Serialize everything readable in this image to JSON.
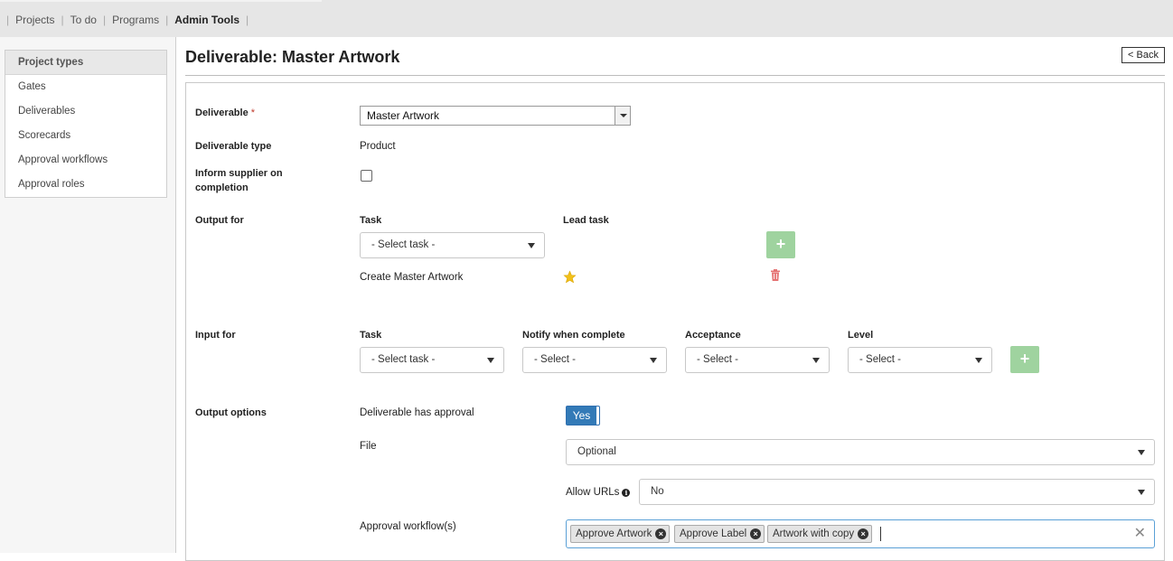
{
  "nav": {
    "items": [
      {
        "label": "Projects"
      },
      {
        "label": "To do"
      },
      {
        "label": "Programs"
      },
      {
        "label": "Admin Tools"
      }
    ]
  },
  "sidebar": {
    "items": [
      {
        "label": "Project types"
      },
      {
        "label": "Gates"
      },
      {
        "label": "Deliverables"
      },
      {
        "label": "Scorecards"
      },
      {
        "label": "Approval workflows"
      },
      {
        "label": "Approval roles"
      }
    ]
  },
  "page": {
    "title": "Deliverable: Master Artwork",
    "back_label": "< Back"
  },
  "form": {
    "deliverable": {
      "label": "Deliverable",
      "required_mark": "*",
      "value": "Master Artwork"
    },
    "deliverable_type": {
      "label": "Deliverable type",
      "value": "Product"
    },
    "inform_supplier": {
      "label_line1": "Inform supplier on",
      "label_line2": "completion",
      "checked": false
    },
    "output_for": {
      "label": "Output for",
      "col_task": "Task",
      "col_lead": "Lead task",
      "task_select": "- Select task -",
      "add_label": "+",
      "rows": [
        {
          "task": "Create Master Artwork",
          "lead": true
        }
      ]
    },
    "input_for": {
      "label": "Input for",
      "col_task": "Task",
      "col_notify": "Notify when complete",
      "col_acceptance": "Acceptance",
      "col_level": "Level",
      "task_select": "- Select task -",
      "notify_select": "- Select -",
      "acceptance_select": "- Select -",
      "level_select": "- Select -",
      "add_label": "+"
    },
    "output_options": {
      "label": "Output options",
      "has_approval_label": "Deliverable has approval",
      "has_approval_value": "Yes",
      "file_label": "File",
      "file_value": "Optional",
      "allow_urls_label": "Allow URLs",
      "allow_urls_value": "No",
      "workflows_label": "Approval workflow(s)",
      "workflows": [
        "Approve Artwork",
        "Approve Label",
        "Artwork with copy"
      ],
      "remove_glyph": "×",
      "clear_glyph": "✕"
    }
  },
  "colors": {
    "accent": "#337ab7",
    "add_button": "#9fd39f",
    "star": "#f2c01a",
    "trash": "#e57373",
    "required": "#c0392b"
  }
}
